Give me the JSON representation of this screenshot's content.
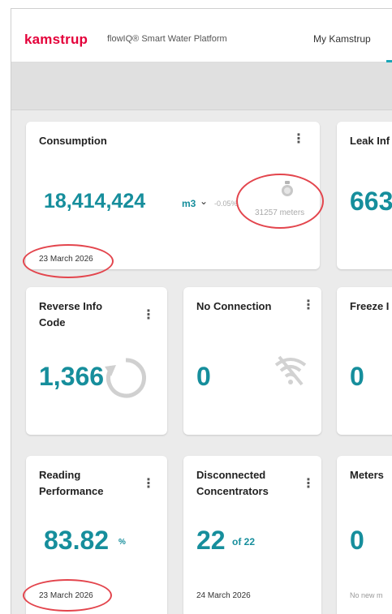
{
  "header": {
    "logo": "kamstrup",
    "platform": "flowIQ® Smart Water Platform",
    "nav_item": "My Kamstrup"
  },
  "consumption": {
    "title": "Consumption",
    "value": "18,414,424",
    "unit": "m3",
    "change": "-0.05%",
    "meters": "31257 meters",
    "date": "23 March 2026"
  },
  "leak": {
    "title": "Leak Inf",
    "value": "663"
  },
  "reverse": {
    "title": "Reverse Info Code",
    "value": "1,366"
  },
  "noconn": {
    "title": "No Connection",
    "value": "0"
  },
  "freeze": {
    "title": "Freeze I",
    "value": "0"
  },
  "reading": {
    "title": "Reading Performance",
    "value": "83.82",
    "unit": "%",
    "date": "23 March 2026"
  },
  "disconnected": {
    "title": "Disconnected Concentrators",
    "value": "22",
    "of_text": "of 22",
    "date": "24 March 2026"
  },
  "meters": {
    "title": "Meters",
    "value": "0",
    "note": "No new m"
  },
  "colors": {
    "accent": "#168e9c",
    "brand": "#e4003a",
    "highlight": "#e3454d"
  },
  "icons": [
    "chevron-down-icon",
    "water-meter-icon",
    "reverse-arrow-icon",
    "wifi-off-icon",
    "kebab-menu-icon"
  ]
}
